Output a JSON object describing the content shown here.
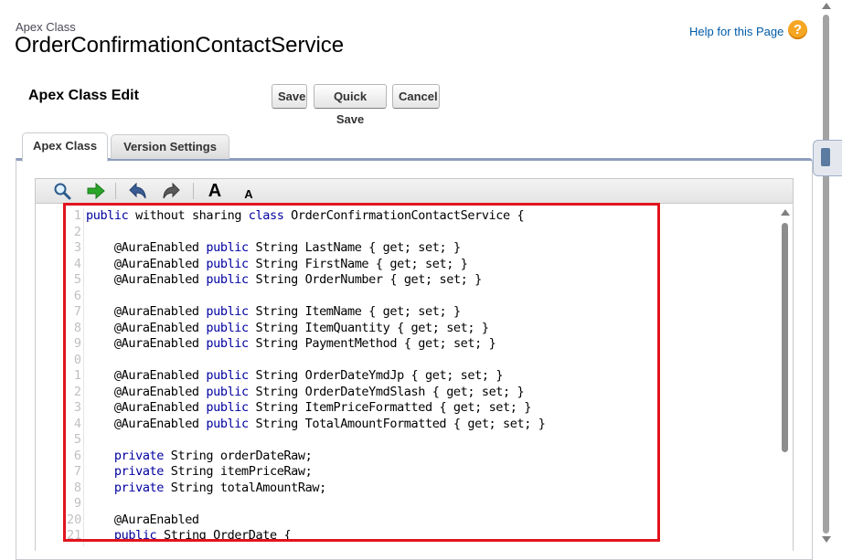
{
  "header": {
    "breadcrumb": "Apex Class",
    "title": "OrderConfirmationContactService",
    "help_link": "Help for this Page",
    "help_icon": "?"
  },
  "section": {
    "title": "Apex Class Edit"
  },
  "buttons": {
    "save": "Save",
    "quick_save": "Quick Save",
    "cancel": "Cancel"
  },
  "tabs": [
    {
      "label": "Apex Class",
      "active": true
    },
    {
      "label": "Version Settings",
      "active": false
    }
  ],
  "toolbar": {
    "icons": [
      "search-icon",
      "go-to-line-icon",
      "undo-icon",
      "redo-icon",
      "increase-font-icon",
      "decrease-font-icon"
    ],
    "font_large": "A",
    "font_small": "A"
  },
  "editor": {
    "line_numbers": [
      "1",
      "2",
      "3",
      "4",
      "5",
      "6",
      "7",
      "8",
      "9",
      "0",
      "1",
      "2",
      "3",
      "4",
      "5",
      "6",
      "7",
      "8",
      "9",
      "20",
      "21"
    ],
    "lines": [
      "public without sharing class OrderConfirmationContactService {",
      "",
      "    @AuraEnabled public String LastName { get; set; }",
      "    @AuraEnabled public String FirstName { get; set; }",
      "    @AuraEnabled public String OrderNumber { get; set; }",
      "",
      "    @AuraEnabled public String ItemName { get; set; }",
      "    @AuraEnabled public String ItemQuantity { get; set; }",
      "    @AuraEnabled public String PaymentMethod { get; set; }",
      "",
      "    @AuraEnabled public String OrderDateYmdJp { get; set; }",
      "    @AuraEnabled public String OrderDateYmdSlash { get; set; }",
      "    @AuraEnabled public String ItemPriceFormatted { get; set; }",
      "    @AuraEnabled public String TotalAmountFormatted { get; set; }",
      "",
      "    private String orderDateRaw;",
      "    private String itemPriceRaw;",
      "    private String totalAmountRaw;",
      "",
      "    @AuraEnabled",
      "    public String OrderDate {"
    ]
  },
  "colors": {
    "highlight_border": "#e1141e",
    "keyword": "#0000a0",
    "help_icon": "#f5a623",
    "link": "#015ba7"
  }
}
